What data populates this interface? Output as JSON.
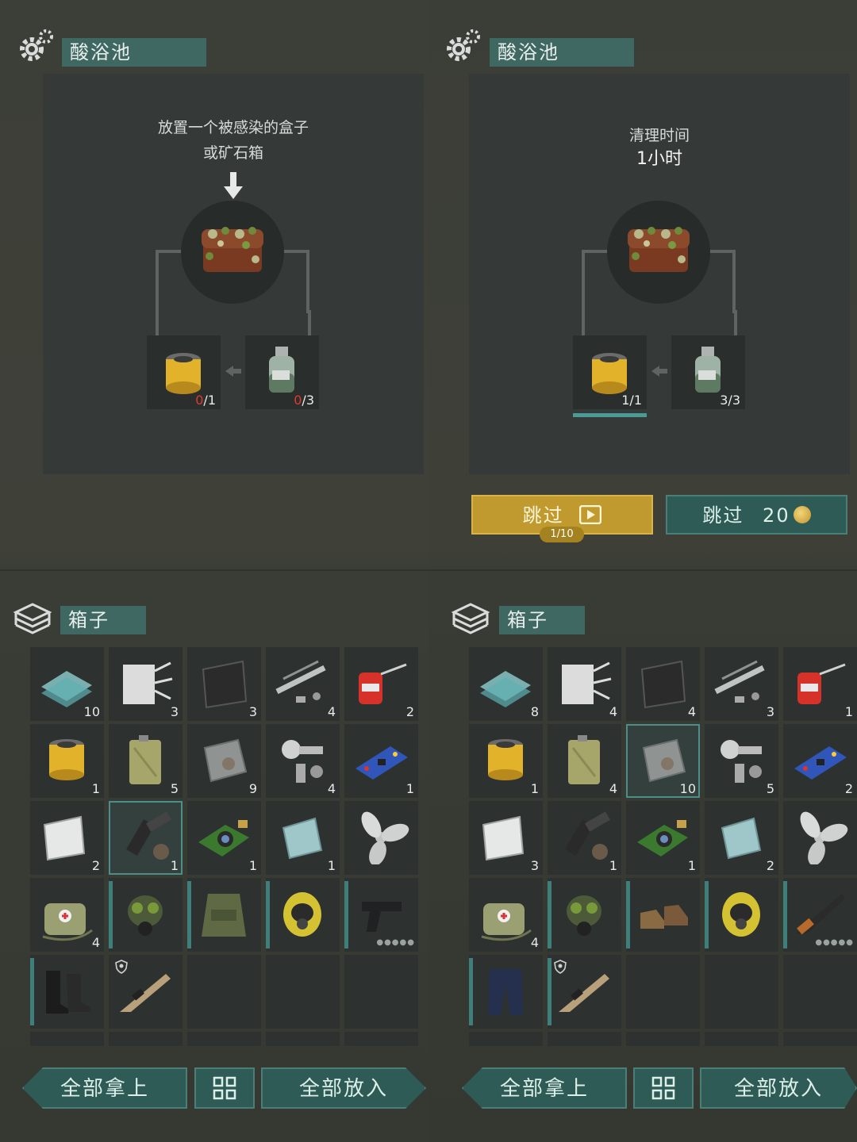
{
  "panels": [
    {
      "title": "酸浴池",
      "hint_line1": "放置一个被感染的盒子",
      "hint_line2": "或矿石箱",
      "filter_count": "0/1",
      "filter_have": "0",
      "filter_need": "/1",
      "acid_have": "0",
      "acid_need": "/3",
      "box_title": "箱子",
      "take_all": "全部拿上",
      "put_all": "全部放入",
      "inventory": [
        {
          "icon": "glass-icon",
          "q": "10"
        },
        {
          "icon": "cloth-roll-icon",
          "q": "3"
        },
        {
          "icon": "rubber-sheet-icon",
          "q": "3"
        },
        {
          "icon": "pipes-icon",
          "q": "4"
        },
        {
          "icon": "oil-can-icon",
          "q": "2"
        },
        {
          "icon": "filter-icon",
          "q": "1"
        },
        {
          "icon": "jerrycan-icon",
          "q": "5"
        },
        {
          "icon": "metal-plate-icon",
          "q": "9"
        },
        {
          "icon": "gun-parts-icon",
          "q": "4"
        },
        {
          "icon": "circuit-board-icon",
          "q": "1"
        },
        {
          "icon": "steel-sheet-icon",
          "q": "2"
        },
        {
          "icon": "weapon-parts-icon",
          "q": "1",
          "hl": true
        },
        {
          "icon": "camera-module-icon",
          "q": "1"
        },
        {
          "icon": "glass-plate-icon",
          "q": "1"
        },
        {
          "icon": "propeller-icon",
          "q": ""
        },
        {
          "icon": "medkit-bag-icon",
          "q": "4"
        },
        {
          "icon": "gas-mask-icon",
          "q": "",
          "bar": true
        },
        {
          "icon": "vest-icon",
          "q": "",
          "bar": true
        },
        {
          "icon": "hazmat-hood-icon",
          "q": "",
          "bar": true
        },
        {
          "icon": "pistol-icon",
          "q": "",
          "bar": true,
          "dots": "●●●●●"
        },
        {
          "icon": "boots-icon",
          "q": "",
          "bar": true
        },
        {
          "icon": "rifle-icon",
          "q": "",
          "shield": true
        },
        {
          "icon": "",
          "q": ""
        },
        {
          "icon": "",
          "q": ""
        },
        {
          "icon": "",
          "q": ""
        }
      ]
    },
    {
      "title": "酸浴池",
      "timer_label": "清理时间",
      "timer_value": "1小时",
      "filter_have": "1",
      "filter_need": "/1",
      "acid_have": "3",
      "acid_need": "/3",
      "skip_ad_label": "跳过",
      "skip_ad_count": "1/10",
      "skip_coin_label": "跳过",
      "skip_coin_cost": "20",
      "box_title": "箱子",
      "take_all": "全部拿上",
      "put_all": "全部放入",
      "inventory": [
        {
          "icon": "glass-icon",
          "q": "8"
        },
        {
          "icon": "cloth-roll-icon",
          "q": "4"
        },
        {
          "icon": "rubber-sheet-icon",
          "q": "4"
        },
        {
          "icon": "pipes-icon",
          "q": "3"
        },
        {
          "icon": "oil-can-icon",
          "q": "1"
        },
        {
          "icon": "filter-icon",
          "q": "1"
        },
        {
          "icon": "jerrycan-icon",
          "q": "4"
        },
        {
          "icon": "metal-plate-icon",
          "q": "10",
          "hl": true
        },
        {
          "icon": "gun-parts-icon",
          "q": "5"
        },
        {
          "icon": "circuit-board-icon",
          "q": "2"
        },
        {
          "icon": "steel-sheet-icon",
          "q": "3"
        },
        {
          "icon": "weapon-parts-icon",
          "q": "1"
        },
        {
          "icon": "camera-module-icon",
          "q": "1"
        },
        {
          "icon": "glass-plate-icon",
          "q": "2"
        },
        {
          "icon": "propeller-icon",
          "q": ""
        },
        {
          "icon": "medkit-bag-icon",
          "q": "4"
        },
        {
          "icon": "gas-mask-icon",
          "q": "",
          "bar": true
        },
        {
          "icon": "shoes-icon",
          "q": "",
          "bar": true
        },
        {
          "icon": "hazmat-hood-icon",
          "q": "",
          "bar": true
        },
        {
          "icon": "shotgun-icon",
          "q": "",
          "bar": true,
          "dots": "●●●●●"
        },
        {
          "icon": "pants-icon",
          "q": "",
          "bar": true
        },
        {
          "icon": "rifle-icon",
          "q": "",
          "shield": true,
          "bar": true
        },
        {
          "icon": "",
          "q": ""
        },
        {
          "icon": "",
          "q": ""
        },
        {
          "icon": "",
          "q": ""
        }
      ]
    }
  ],
  "colors": {
    "accent": "#3f6862",
    "gold": "#c09a2e",
    "alert": "#e03a2e",
    "highlight": "#4c8e8a"
  }
}
